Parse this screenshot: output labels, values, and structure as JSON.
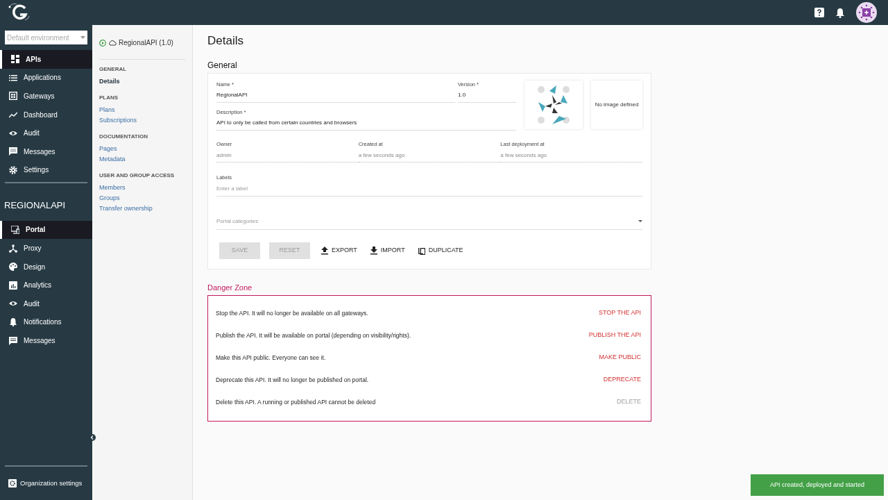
{
  "environment_select": {
    "placeholder": "Default environment"
  },
  "nav": {
    "items": [
      {
        "label": "APIs",
        "selected": true
      },
      {
        "label": "Applications",
        "selected": false
      },
      {
        "label": "Gateways",
        "selected": false
      },
      {
        "label": "Dashboard",
        "selected": false
      },
      {
        "label": "Audit",
        "selected": false
      },
      {
        "label": "Messages",
        "selected": false
      },
      {
        "label": "Settings",
        "selected": false
      }
    ]
  },
  "api_section": {
    "title": "REGIONALAPI",
    "items": [
      {
        "label": "Portal",
        "selected": true
      },
      {
        "label": "Proxy",
        "selected": false
      },
      {
        "label": "Design",
        "selected": false
      },
      {
        "label": "Analytics",
        "selected": false
      },
      {
        "label": "Audit",
        "selected": false
      },
      {
        "label": "Notifications",
        "selected": false
      },
      {
        "label": "Messages",
        "selected": false
      }
    ]
  },
  "organization_settings": "Organization settings",
  "api_menu": {
    "title": "RegionalAPI (1.0)",
    "running": true,
    "groups": [
      {
        "heading": "GENERAL",
        "items": [
          {
            "label": "Details",
            "selected": true
          }
        ]
      },
      {
        "heading": "PLANS",
        "items": [
          {
            "label": "Plans",
            "selected": false
          },
          {
            "label": "Subscriptions",
            "selected": false
          }
        ]
      },
      {
        "heading": "DOCUMENTATION",
        "items": [
          {
            "label": "Pages",
            "selected": false
          },
          {
            "label": "Metadata",
            "selected": false
          }
        ]
      },
      {
        "heading": "USER AND GROUP ACCESS",
        "items": [
          {
            "label": "Members",
            "selected": false
          },
          {
            "label": "Groups",
            "selected": false
          },
          {
            "label": "Transfer ownership",
            "selected": false
          }
        ]
      }
    ]
  },
  "page_title": "Details",
  "general": {
    "heading": "General",
    "name": {
      "label": "Name *",
      "value": "RegionalAPI"
    },
    "version": {
      "label": "Version *",
      "value": "1.0"
    },
    "description": {
      "label": "Description *",
      "value": "API to only be called from certain countries and browsers"
    },
    "info": [
      {
        "label": "Owner",
        "value": "admin"
      },
      {
        "label": "Created at",
        "value": "a few seconds ago"
      },
      {
        "label": "Last deployment at",
        "value": "a few seconds ago"
      }
    ],
    "labels": {
      "label": "Labels",
      "placeholder": "Enter a label"
    },
    "categories": {
      "placeholder": "Portal categories"
    },
    "background_image": "No image defined",
    "buttons": [
      {
        "label": "SAVE",
        "kind": "filled",
        "disabled": true
      },
      {
        "label": "RESET",
        "kind": "filled",
        "disabled": true
      },
      {
        "label": "EXPORT",
        "kind": "icon",
        "disabled": false
      },
      {
        "label": "IMPORT",
        "kind": "icon",
        "disabled": false
      },
      {
        "label": "DUPLICATE",
        "kind": "icon",
        "disabled": false
      }
    ]
  },
  "danger_zone": {
    "heading": "Danger Zone",
    "rows": [
      {
        "text": "Stop the API. It will no longer be available on all gateways.",
        "action": "STOP THE API",
        "disabled": false
      },
      {
        "text": "Publish the API. It will be available on portal (depending on visibility/rights).",
        "action": "PUBLISH THE API",
        "disabled": false
      },
      {
        "text": "Make this API public. Everyone can see it.",
        "action": "MAKE PUBLIC",
        "disabled": false
      },
      {
        "text": "Deprecate this API. It will no longer be published on portal.",
        "action": "DEPRECATE",
        "disabled": false
      },
      {
        "text": "Delete this API. A running or published API cannot be deleted",
        "action": "DELETE",
        "disabled": true
      }
    ]
  },
  "toast": "API created, deployed and started"
}
